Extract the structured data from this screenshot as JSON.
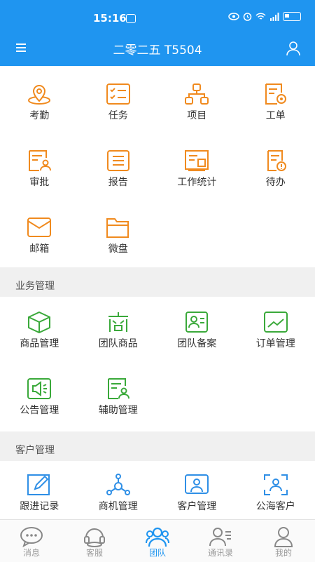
{
  "status_bar": {
    "time": "15:16"
  },
  "header": {
    "title": "二零二五 T5504"
  },
  "colors": {
    "primary": "#1f95f0",
    "orange": "#f08a1e",
    "green": "#3aa93a",
    "blue": "#2f8fe6"
  },
  "sections": {
    "main": [
      {
        "label": "考勤",
        "icon": "location-pin-icon"
      },
      {
        "label": "任务",
        "icon": "checklist-icon"
      },
      {
        "label": "项目",
        "icon": "hierarchy-icon"
      },
      {
        "label": "工单",
        "icon": "document-gear-icon"
      },
      {
        "label": "审批",
        "icon": "document-user-icon"
      },
      {
        "label": "报告",
        "icon": "report-icon"
      },
      {
        "label": "工作统计",
        "icon": "stats-board-icon"
      },
      {
        "label": "待办",
        "icon": "todo-alert-icon"
      },
      {
        "label": "邮箱",
        "icon": "mail-icon"
      },
      {
        "label": "微盘",
        "icon": "folder-icon"
      }
    ],
    "business": {
      "title": "业务管理",
      "items": [
        {
          "label": "商品管理",
          "icon": "box-icon"
        },
        {
          "label": "团队商品",
          "icon": "team-goods-icon"
        },
        {
          "label": "团队备案",
          "icon": "contact-card-icon"
        },
        {
          "label": "订单管理",
          "icon": "trend-chart-icon"
        },
        {
          "label": "公告管理",
          "icon": "announcement-icon"
        },
        {
          "label": "辅助管理",
          "icon": "assist-icon"
        }
      ]
    },
    "customer": {
      "title": "客户管理",
      "items": [
        {
          "label": "跟进记录",
          "icon": "edit-note-icon"
        },
        {
          "label": "商机管理",
          "icon": "network-icon"
        },
        {
          "label": "客户管理",
          "icon": "customer-card-icon"
        },
        {
          "label": "公海客户",
          "icon": "scan-user-icon"
        }
      ]
    }
  },
  "tabs": [
    {
      "label": "消息",
      "icon": "chat-icon"
    },
    {
      "label": "客服",
      "icon": "headset-icon"
    },
    {
      "label": "团队",
      "icon": "team-icon",
      "active": true
    },
    {
      "label": "通讯录",
      "icon": "contacts-icon"
    },
    {
      "label": "我的",
      "icon": "profile-icon"
    }
  ]
}
